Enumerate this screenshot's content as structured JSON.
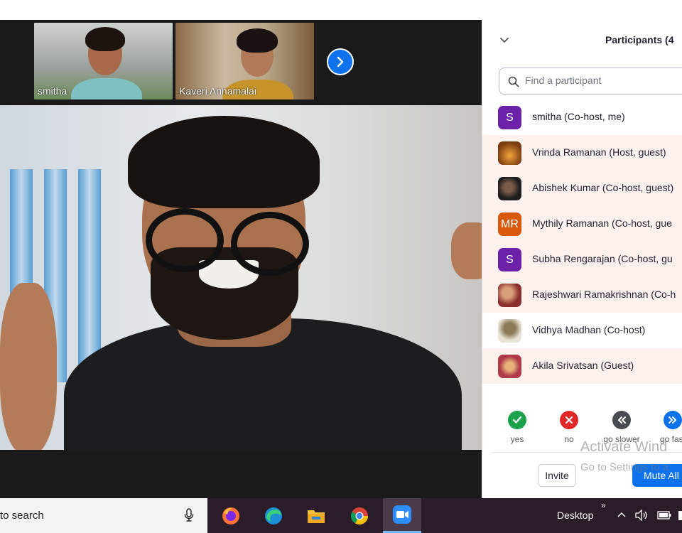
{
  "thumbnails": [
    {
      "name": "smitha"
    },
    {
      "name": "Kaveri Annamalai"
    }
  ],
  "panel": {
    "title": "Participants (4",
    "search_placeholder": "Find a participant"
  },
  "participants": [
    {
      "name": "smitha (Co-host, me)",
      "initials": "S",
      "avatar_color": "#6b21a8",
      "highlighted": false
    },
    {
      "name": "Vrinda Ramanan (Host, guest)",
      "initials": "",
      "avatar_color": "#7a3b10",
      "highlighted": true
    },
    {
      "name": "Abishek Kumar (Co-host, guest)",
      "initials": "",
      "avatar_color": "#1e1e1e",
      "highlighted": true
    },
    {
      "name": "Mythily Ramanan (Co-host, gue",
      "initials": "MR",
      "avatar_color": "#d9590c",
      "highlighted": true
    },
    {
      "name": "Subha Rengarajan (Co-host, gu",
      "initials": "S",
      "avatar_color": "#6b21a8",
      "highlighted": true
    },
    {
      "name": "Rajeshwari Ramakrishnan (Co-h",
      "initials": "",
      "avatar_color": "#8a2e2e",
      "highlighted": true
    },
    {
      "name": "Vidhya Madhan (Co-host)",
      "initials": "",
      "avatar_color": "#e9e3d6",
      "highlighted": false
    },
    {
      "name": "Akila Srivatsan (Guest)",
      "initials": "",
      "avatar_color": "#b03a4a",
      "highlighted": true
    }
  ],
  "feedback": [
    {
      "label": "yes",
      "color": "#1aa34a",
      "icon": "check-icon"
    },
    {
      "label": "no",
      "color": "#e02828",
      "icon": "x-icon"
    },
    {
      "label": "go slower",
      "color": "#4a4a52",
      "icon": "rewind-icon"
    },
    {
      "label": "go fast",
      "color": "#0e72ed",
      "icon": "fast-forward-icon"
    }
  ],
  "buttons": {
    "invite": "Invite",
    "mute_all": "Mute All"
  },
  "watermark": {
    "line1": "Activate Wind",
    "line2": "Go to Settings to a"
  },
  "taskbar": {
    "search_text": "to search",
    "desktop_label": "Desktop",
    "apps": [
      "firefox-icon",
      "edge-icon",
      "file-explorer-icon",
      "chrome-icon",
      "zoom-icon"
    ]
  },
  "colors": {
    "accent": "#0e72ed",
    "highlight_row": "#fdf1ed"
  }
}
